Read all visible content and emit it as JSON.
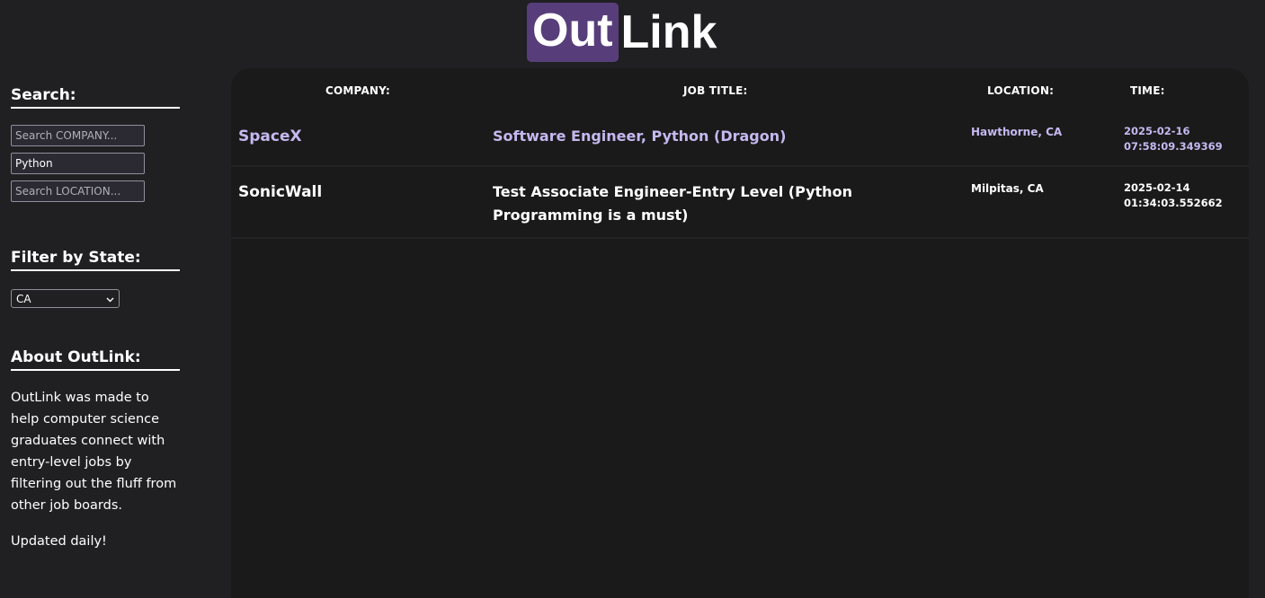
{
  "logo": {
    "part1": "Out",
    "part2": "Link"
  },
  "sidebar": {
    "search_heading": "Search:",
    "company_placeholder": "Search COMPANY...",
    "title_value": "Python",
    "location_placeholder": "Search LOCATION...",
    "filter_heading": "Filter by State:",
    "state_selected": "CA",
    "about_heading": "About OutLink:",
    "about_text": "OutLink was made to help computer science graduates connect with entry-level jobs by filtering out the fluff from other job boards.",
    "updated_text": "Updated daily!"
  },
  "table": {
    "headers": {
      "company": "COMPANY:",
      "title": "JOB TITLE:",
      "location": "LOCATION:",
      "time": "TIME:"
    },
    "rows": [
      {
        "company": "SpaceX",
        "title": "Software Engineer, Python (Dragon)",
        "location": "Hawthorne, CA",
        "date": "2025-02-16",
        "time": "07:58:09.349369"
      },
      {
        "company": "SonicWall",
        "title": "Test Associate Engineer-Entry Level (Python Programming is a must)",
        "location": "Milpitas, CA",
        "date": "2025-02-14",
        "time": "01:34:03.552662"
      }
    ]
  },
  "colors": {
    "brand": "#573e7a",
    "visited_link": "#c5b9f0",
    "background": "#202023",
    "panel": "#1a1a1a"
  }
}
